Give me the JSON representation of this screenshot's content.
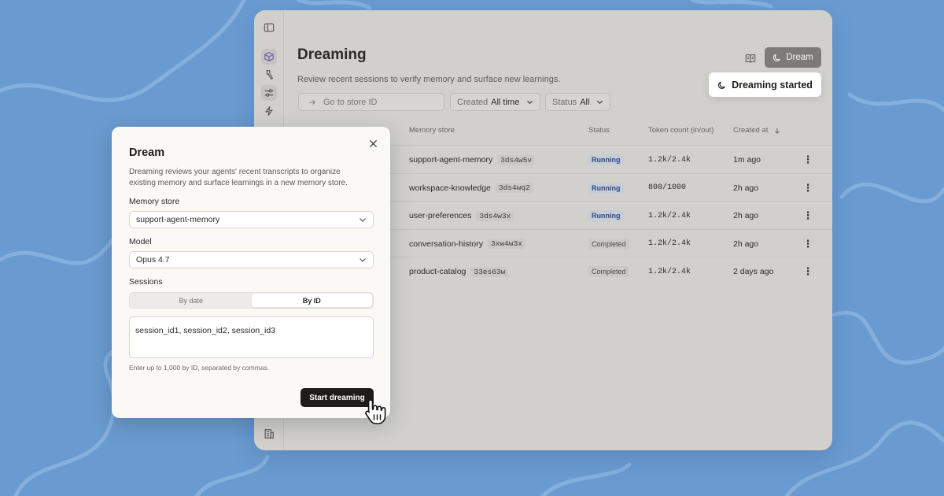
{
  "colors": {
    "background": "#6a9bd0",
    "app_overlay": "#d1d0cc",
    "primary_button": "#1d1c1a",
    "running_badge_text": "#2c4b82"
  },
  "sidebar": {
    "icons": [
      "sidebar-toggle-icon",
      "cube-icon",
      "tool-icon",
      "sliders-icon",
      "lightning-icon",
      "building-icon"
    ]
  },
  "header": {
    "title": "Dreaming",
    "subtitle": "Review recent sessions to verify memory and surface new learnings.",
    "dream_button_label": "Dream",
    "toast": "Dreaming started"
  },
  "filters": {
    "search_placeholder": "Go to store ID",
    "created_label": "Created",
    "created_value": "All time",
    "status_label": "Status",
    "status_value": "All"
  },
  "table": {
    "columns": {
      "memory_store": "Memory store",
      "status": "Status",
      "tokens": "Token count (in/out)",
      "created": "Created at"
    },
    "rows": [
      {
        "name": "support-agent-memory",
        "id": "3ds4w5v",
        "status": "Running",
        "tokens": "1.2k/2.4k",
        "created": "1m ago"
      },
      {
        "name": "workspace-knowledge",
        "id": "3ds4wq2",
        "status": "Running",
        "tokens": "800/1000",
        "created": "2h ago"
      },
      {
        "name": "user-preferences",
        "id": "3ds4w3x",
        "status": "Running",
        "tokens": "1.2k/2.4k",
        "created": "2h ago"
      },
      {
        "name": "conversation-history",
        "id": "3xw4w3x",
        "status": "Completed",
        "tokens": "1.2k/2.4k",
        "created": "2h ago"
      },
      {
        "name": "product-catalog",
        "id": "33es63w",
        "status": "Completed",
        "tokens": "1.2k/2.4k",
        "created": "2 days ago"
      }
    ]
  },
  "modal": {
    "title": "Dream",
    "description": "Dreaming reviews your agents' recent transcripts to organize existing memory and surface learnings in a new memory store.",
    "memory_store_label": "Memory store",
    "memory_store_value": "support-agent-memory",
    "model_label": "Model",
    "model_value": "Opus 4.7",
    "sessions_label": "Sessions",
    "tab_by_date": "By date",
    "tab_by_id": "By ID",
    "sessions_value": "session_id1, session_id2, session_id3",
    "helper": "Enter up to 1,000 by ID, separated by commas.",
    "submit_label": "Start dreaming"
  }
}
